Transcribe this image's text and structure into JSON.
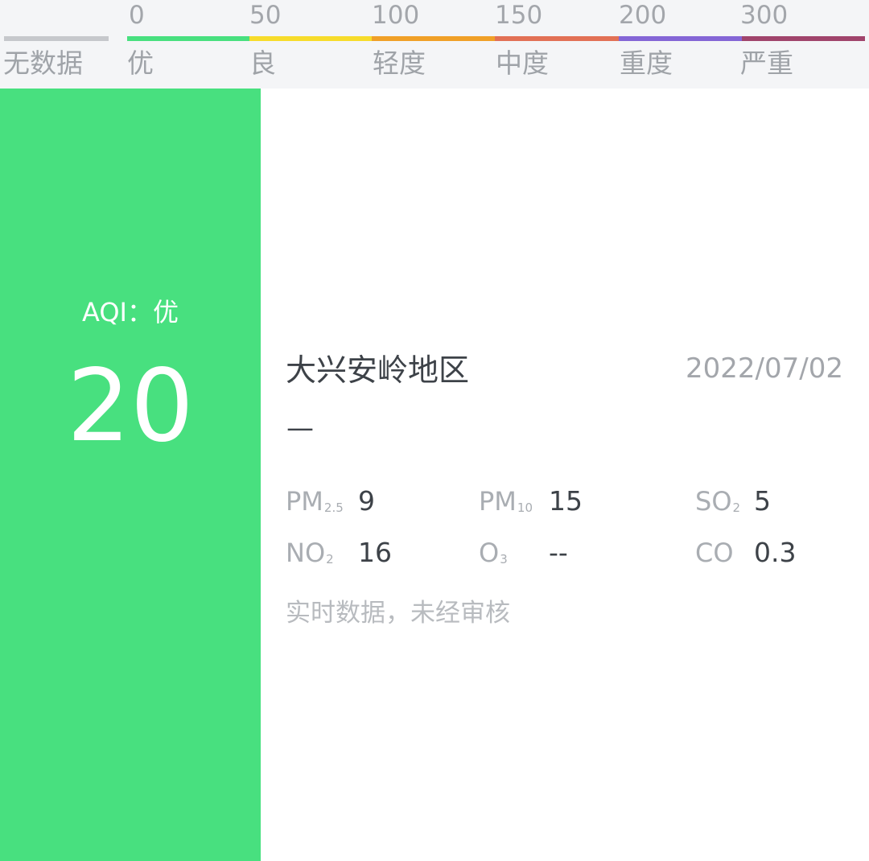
{
  "legend": {
    "ticks": [
      "0",
      "50",
      "100",
      "150",
      "200",
      "300"
    ],
    "categories": [
      {
        "label": "无数据",
        "color": "#c6c8cc"
      },
      {
        "label": "优",
        "color": "#48e07f"
      },
      {
        "label": "良",
        "color": "#f7dc2b"
      },
      {
        "label": "轻度",
        "color": "#f0a028"
      },
      {
        "label": "中度",
        "color": "#e27155"
      },
      {
        "label": "重度",
        "color": "#8466d6"
      },
      {
        "label": "严重",
        "color": "#a0446c"
      }
    ]
  },
  "aqi": {
    "label": "AQI：优",
    "value": "20",
    "color": "#48e07f"
  },
  "station": {
    "region": "大兴安岭地区",
    "date": "2022/07/02",
    "primary_pollutant": "—"
  },
  "pollutants": [
    {
      "name": "PM",
      "sub": "2.5",
      "value": "9"
    },
    {
      "name": "PM",
      "sub": "10",
      "value": "15"
    },
    {
      "name": "SO",
      "sub": "2",
      "value": "5"
    },
    {
      "name": "NO",
      "sub": "2",
      "value": "16"
    },
    {
      "name": "O",
      "sub": "3",
      "value": "--"
    },
    {
      "name": "CO",
      "sub": "",
      "value": "0.3"
    }
  ],
  "note": "实时数据，未经审核"
}
